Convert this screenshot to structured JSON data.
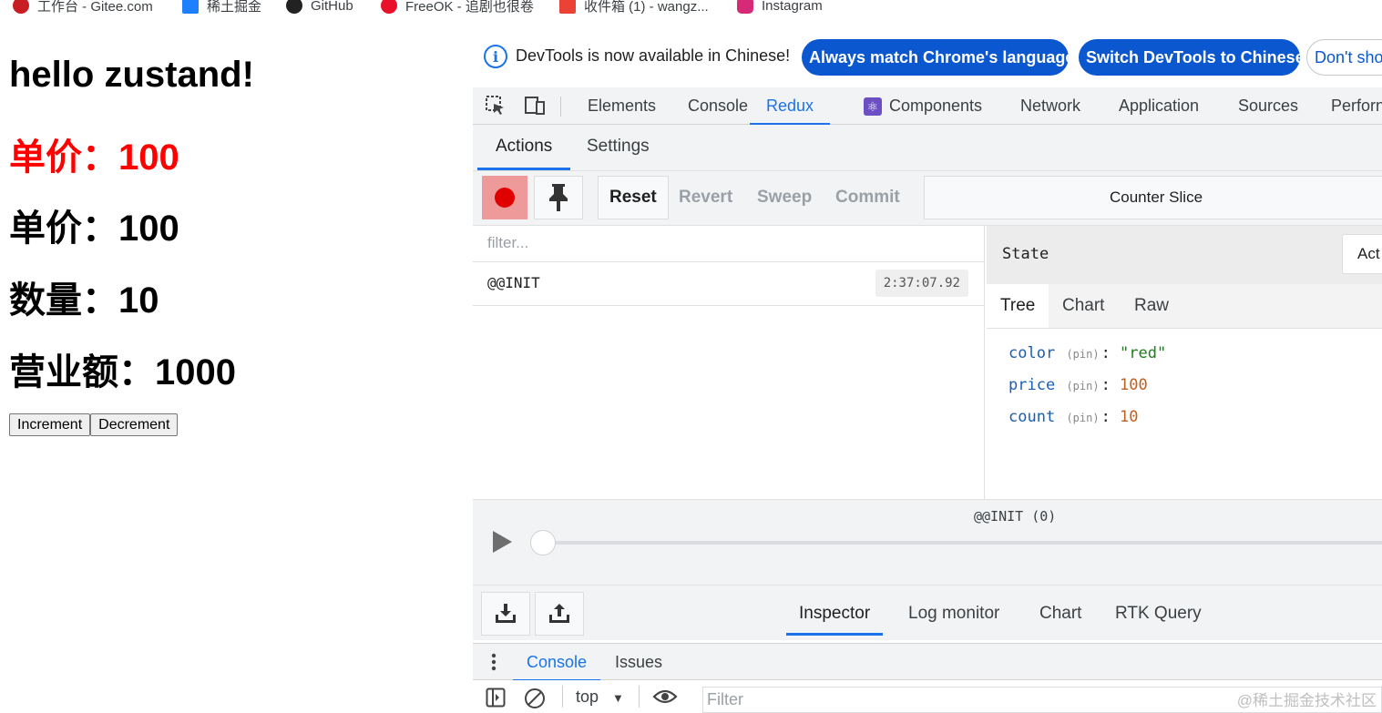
{
  "bookmarks": [
    {
      "label": "工作台 - Gitee.com",
      "icon": "gitee-icon"
    },
    {
      "label": "稀土掘金",
      "icon": "juejin-icon"
    },
    {
      "label": "GitHub",
      "icon": "github-icon"
    },
    {
      "label": "FreeOK - 追剧也很卷",
      "icon": "freeok-icon"
    },
    {
      "label": "收件箱 (1) - wangz...",
      "icon": "gmail-icon"
    },
    {
      "label": "Instagram",
      "icon": "instagram-icon"
    }
  ],
  "app": {
    "title": "hello zustand!",
    "price_red": "单价：100",
    "price": "单价：100",
    "count": "数量：10",
    "revenue": "营业额：1000",
    "increment_label": "Increment",
    "decrement_label": "Decrement"
  },
  "devtools": {
    "infobar": {
      "text": "DevTools is now available in Chinese!",
      "match_label": "Always match Chrome's language",
      "switch_label": "Switch DevTools to Chinese",
      "dont_show_label": "Don't sho"
    },
    "tabs": [
      "Elements",
      "Console",
      "Redux",
      "Components",
      "Network",
      "Application",
      "Sources",
      "Perforn"
    ],
    "active_tab": "Redux",
    "redux": {
      "subtabs": [
        "Actions",
        "Settings"
      ],
      "buttons": {
        "reset": "Reset",
        "revert": "Revert",
        "sweep": "Sweep",
        "commit": "Commit"
      },
      "instance": "Counter Slice",
      "filter_placeholder": "filter...",
      "actions": [
        {
          "name": "@@INIT",
          "time": "2:37:07.92"
        }
      ],
      "state_title": "State",
      "action_btn": "Act",
      "state_tabs": [
        "Tree",
        "Chart",
        "Raw"
      ],
      "state": [
        {
          "key": "color",
          "pin": "(pin)",
          "value": "\"red\"",
          "type": "string"
        },
        {
          "key": "price",
          "pin": "(pin)",
          "value": "100",
          "type": "number"
        },
        {
          "key": "count",
          "pin": "(pin)",
          "value": "10",
          "type": "number"
        }
      ],
      "slider_label": "@@INIT (0)",
      "monitor_tabs": [
        "Inspector",
        "Log monitor",
        "Chart",
        "RTK Query"
      ]
    },
    "drawer": {
      "tabs": [
        "Console",
        "Issues"
      ],
      "context": "top",
      "filter_placeholder": "Filter"
    }
  },
  "watermark": "@稀土掘金技术社区",
  "colors": {
    "accent": "#1a73e8",
    "pill": "#0b57d0",
    "record": "#e00000",
    "price_red": "#ff0000"
  }
}
